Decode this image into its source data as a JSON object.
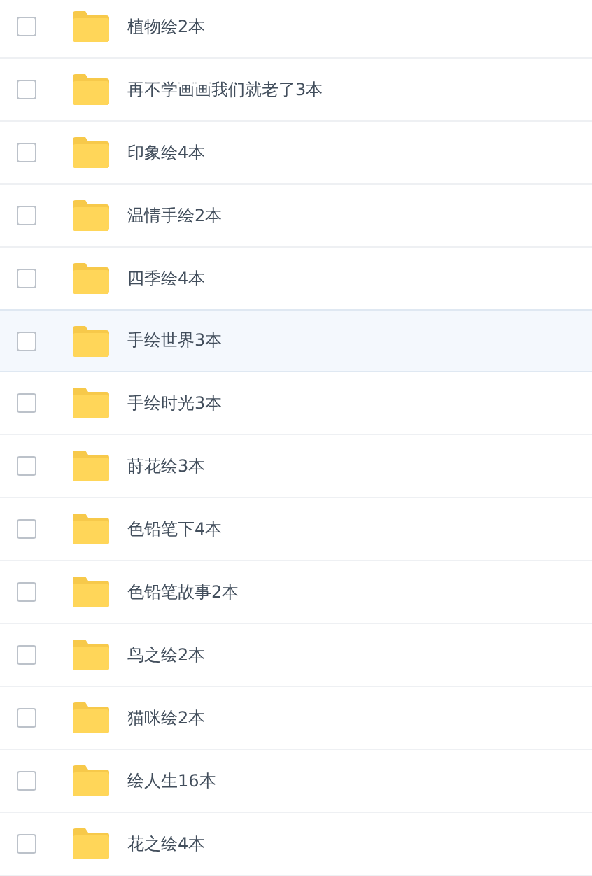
{
  "folders": [
    {
      "name": "植物绘2本",
      "checked": false,
      "selected": false
    },
    {
      "name": "再不学画画我们就老了3本",
      "checked": false,
      "selected": false
    },
    {
      "name": "印象绘4本",
      "checked": false,
      "selected": false
    },
    {
      "name": "温情手绘2本",
      "checked": false,
      "selected": false
    },
    {
      "name": "四季绘4本",
      "checked": false,
      "selected": false
    },
    {
      "name": "手绘世界3本",
      "checked": false,
      "selected": true
    },
    {
      "name": "手绘时光3本",
      "checked": false,
      "selected": false
    },
    {
      "name": "莳花绘3本",
      "checked": false,
      "selected": false
    },
    {
      "name": "色铅笔下4本",
      "checked": false,
      "selected": false
    },
    {
      "name": "色铅笔故事2本",
      "checked": false,
      "selected": false
    },
    {
      "name": "鸟之绘2本",
      "checked": false,
      "selected": false
    },
    {
      "name": "猫咪绘2本",
      "checked": false,
      "selected": false
    },
    {
      "name": "绘人生16本",
      "checked": false,
      "selected": false
    },
    {
      "name": "花之绘4本",
      "checked": false,
      "selected": false
    }
  ]
}
